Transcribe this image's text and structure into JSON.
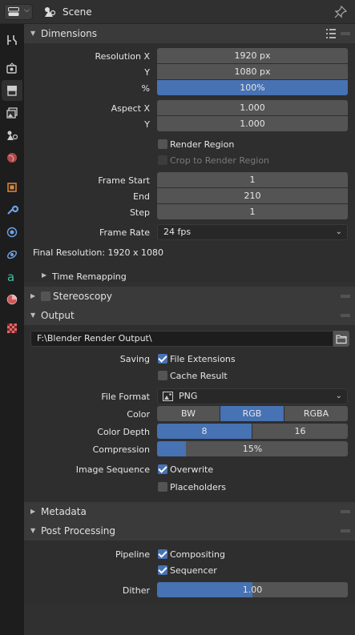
{
  "header": {
    "title": "Scene",
    "editor_type_icon": "properties-editor-icon",
    "pin_icon": "pin-icon"
  },
  "tabs": [
    {
      "name": "tab-tool",
      "icon": "tool-icon"
    },
    {
      "name": "tab-render",
      "icon": "render-icon"
    },
    {
      "name": "tab-output",
      "icon": "output-icon",
      "active": true
    },
    {
      "name": "tab-view-layer",
      "icon": "view-layer-icon"
    },
    {
      "name": "tab-scene",
      "icon": "scene-icon"
    },
    {
      "name": "tab-world",
      "icon": "world-icon"
    },
    {
      "name": "tab-object",
      "icon": "object-icon"
    },
    {
      "name": "tab-modifiers",
      "icon": "wrench-icon"
    },
    {
      "name": "tab-particles",
      "icon": "particles-icon"
    },
    {
      "name": "tab-physics",
      "icon": "physics-icon"
    },
    {
      "name": "tab-constraints",
      "icon": "constraints-icon"
    },
    {
      "name": "tab-data",
      "icon": "data-icon"
    },
    {
      "name": "tab-material",
      "icon": "material-icon"
    },
    {
      "name": "tab-texture",
      "icon": "texture-icon"
    }
  ],
  "dimensions": {
    "title": "Dimensions",
    "resolution_x_label": "Resolution X",
    "resolution_x": "1920 px",
    "y_label": "Y",
    "resolution_y": "1080 px",
    "percent_label": "%",
    "percent": "100%",
    "aspect_x_label": "Aspect X",
    "aspect_x": "1.000",
    "aspect_y_label": "Y",
    "aspect_y": "1.000",
    "render_region": "Render Region",
    "crop_region": "Crop to Render Region",
    "frame_start_label": "Frame Start",
    "frame_start": "1",
    "end_label": "End",
    "frame_end": "210",
    "step_label": "Step",
    "frame_step": "1",
    "frame_rate_label": "Frame Rate",
    "frame_rate": "24 fps",
    "final_resolution": "Final Resolution: 1920 x 1080",
    "time_remapping": "Time Remapping"
  },
  "stereoscopy": {
    "title": "Stereoscopy"
  },
  "output": {
    "title": "Output",
    "path": "F:\\Blender Render Output\\",
    "saving_label": "Saving",
    "file_extensions": "File Extensions",
    "cache_result": "Cache Result",
    "file_format_label": "File Format",
    "file_format": "PNG",
    "color_label": "Color",
    "color_options": [
      "BW",
      "RGB",
      "RGBA"
    ],
    "color_selected": "RGB",
    "color_depth_label": "Color Depth",
    "depth_options": [
      "8",
      "16"
    ],
    "depth_selected": "8",
    "compression_label": "Compression",
    "compression": "15%",
    "compression_fraction": 0.15,
    "image_sequence_label": "Image Sequence",
    "overwrite": "Overwrite",
    "placeholders": "Placeholders"
  },
  "metadata": {
    "title": "Metadata"
  },
  "post_processing": {
    "title": "Post Processing",
    "pipeline_label": "Pipeline",
    "compositing": "Compositing",
    "sequencer": "Sequencer",
    "dither_label": "Dither",
    "dither": "1.00",
    "dither_fraction": 0.5
  },
  "colors": {
    "accent": "#4772b3",
    "panel_header": "#3a3a3a",
    "field": "#545454",
    "background": "#303030"
  }
}
